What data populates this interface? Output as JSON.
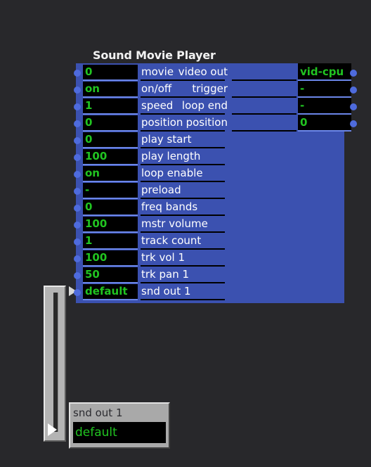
{
  "background_color": "#28282b",
  "colors": {
    "panel_blue": "#3b51b0",
    "value_green": "#21c421",
    "label_white": "#ffffff",
    "box_black": "#000000",
    "dot_blue": "#4e6bdd",
    "rule_blue": "#6b86e8",
    "widget_gray": "#b4b4b4"
  },
  "patch": {
    "title": "Sound Movie Player",
    "inlets": [
      {
        "value": "0",
        "label": "movie"
      },
      {
        "value": "on",
        "label": "on/off"
      },
      {
        "value": "1",
        "label": "speed"
      },
      {
        "value": "0",
        "label": "position"
      },
      {
        "value": "0",
        "label": "play start"
      },
      {
        "value": "100",
        "label": "play length"
      },
      {
        "value": "on",
        "label": "loop enable"
      },
      {
        "value": "-",
        "label": "preload"
      },
      {
        "value": "0",
        "label": "freq bands"
      },
      {
        "value": "100",
        "label": "mstr volume"
      },
      {
        "value": "1",
        "label": "track count"
      },
      {
        "value": "100",
        "label": "trk vol 1"
      },
      {
        "value": "50",
        "label": "trk pan 1"
      },
      {
        "value": "default",
        "label": "snd out 1",
        "selected": true
      }
    ],
    "outlets": [
      {
        "label": "video out",
        "value": "vid-cpu"
      },
      {
        "label": "trigger",
        "value": "-"
      },
      {
        "label": "loop end",
        "value": "-"
      },
      {
        "label": "position",
        "value": "0"
      }
    ]
  },
  "scrollbar": {
    "name": "vertical-scrollbar",
    "arrow_icon": "triangle-right-icon"
  },
  "popup": {
    "title": "snd out 1",
    "options": [
      {
        "label": "default",
        "selected": true
      }
    ]
  }
}
